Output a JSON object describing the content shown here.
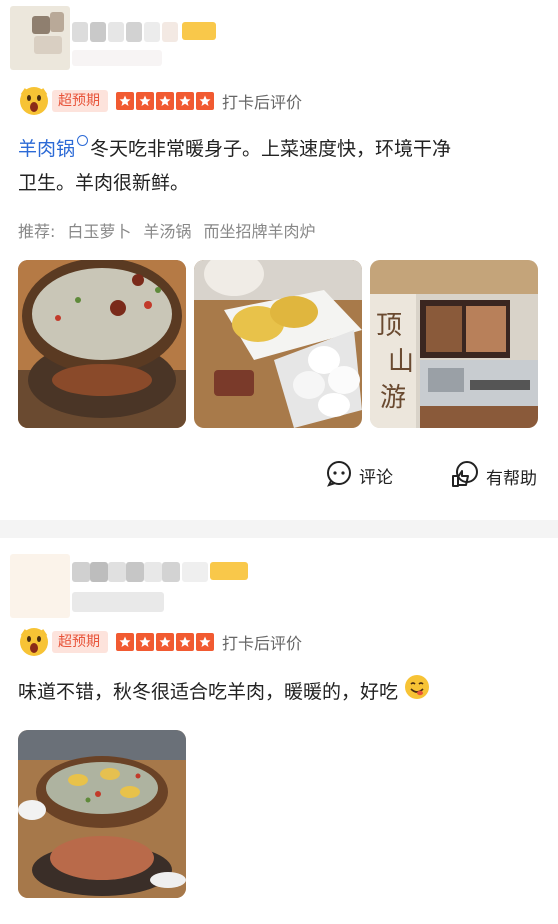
{
  "reviews": [
    {
      "mood_label": "超预期",
      "rating_stars": 5,
      "checkin_label": "打卡后评价",
      "dish_tag": "羊肉锅",
      "text_line1_rest": "冬天吃非常暖身子。上菜速度快，环境干净",
      "text_line2": "卫生。羊肉很新鲜。",
      "recommend_label": "推荐:",
      "recommend_items": [
        "白玉萝卜",
        "羊汤锅",
        "而坐招牌羊肉炉"
      ],
      "photos": [
        "mutton-soup-pot-photo",
        "noodles-and-radish-photo",
        "restaurant-kitchen-photo"
      ],
      "actions": {
        "comment": "评论",
        "helpful": "有帮助"
      }
    },
    {
      "mood_label": "超预期",
      "rating_stars": 5,
      "checkin_label": "打卡后评价",
      "text": "味道不错，秋冬很适合吃羊肉，暖暖的，好吃",
      "emoji": "yum-face",
      "photos": [
        "hotpot-on-stove-photo"
      ]
    }
  ],
  "colors": {
    "accent": "#f15a31",
    "link": "#2c6ad6",
    "mood_bg": "#fde3dc"
  }
}
